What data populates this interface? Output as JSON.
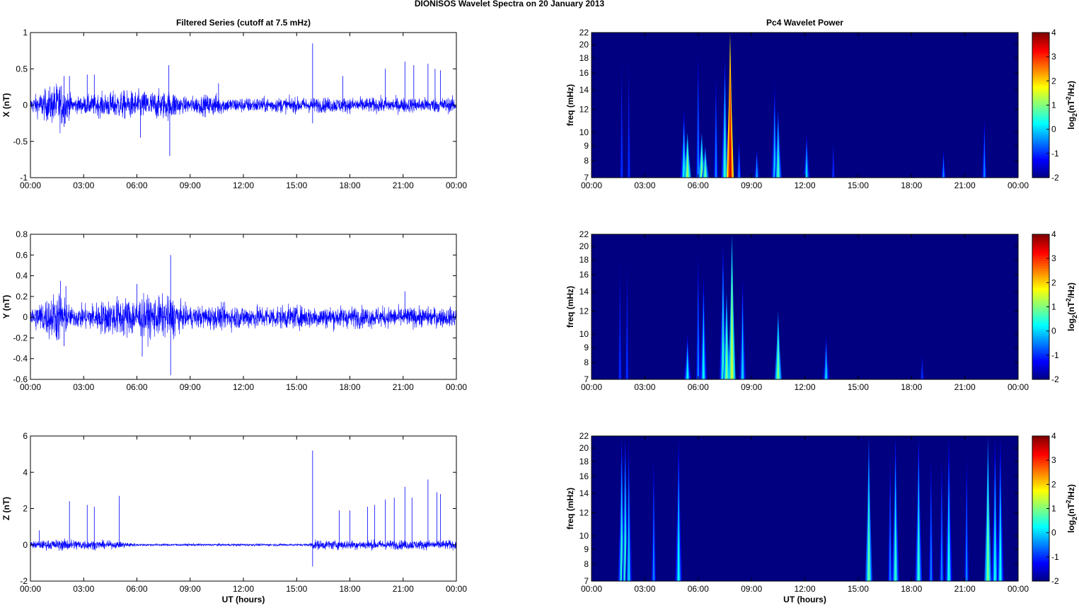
{
  "title": "DIONISOS Wavelet Spectra on 20 January   2013",
  "chart_data": [
    {
      "type": "line",
      "panel": "X",
      "title": "Filtered Series (cutoff at 7.5 mHz)",
      "ylabel": "X (nT)",
      "xlabel": "",
      "ylim": [
        -1,
        1
      ],
      "yticks": [
        "-1",
        "-0.5",
        "0",
        "0.5",
        "1"
      ],
      "ytick_values": [
        -1,
        -0.5,
        0,
        0.5,
        1
      ],
      "xlim": [
        0,
        24
      ],
      "xticks": [
        "00:00",
        "03:00",
        "06:00",
        "09:00",
        "12:00",
        "15:00",
        "18:00",
        "21:00",
        "00:00"
      ],
      "noise_envelope": [
        [
          0,
          0.08
        ],
        [
          1.7,
          0.25
        ],
        [
          2.4,
          0.08
        ],
        [
          5,
          0.15
        ],
        [
          8.2,
          0.15
        ],
        [
          8.5,
          0.08
        ],
        [
          10.5,
          0.12
        ],
        [
          11,
          0.08
        ],
        [
          24,
          0.08
        ]
      ],
      "spikes": [
        [
          1.9,
          0.4
        ],
        [
          2.2,
          0.4
        ],
        [
          1.9,
          -0.3
        ],
        [
          3.2,
          0.42
        ],
        [
          3.6,
          0.42
        ],
        [
          6.2,
          -0.45
        ],
        [
          7.8,
          0.55
        ],
        [
          7.85,
          -0.7
        ],
        [
          10.6,
          0.3
        ],
        [
          15.9,
          0.85
        ],
        [
          15.9,
          -0.25
        ],
        [
          17.6,
          0.4
        ],
        [
          20,
          0.5
        ],
        [
          21.1,
          0.6
        ],
        [
          21.6,
          0.55
        ],
        [
          22.4,
          0.57
        ],
        [
          22.8,
          0.5
        ],
        [
          23.1,
          0.48
        ]
      ]
    },
    {
      "type": "line",
      "panel": "Y",
      "title": "",
      "ylabel": "Y (nT)",
      "xlabel": "",
      "ylim": [
        -0.6,
        0.8
      ],
      "yticks": [
        "-0.6",
        "-0.4",
        "-0.2",
        "0",
        "0.2",
        "0.4",
        "0.6",
        "0.8"
      ],
      "ytick_values": [
        -0.6,
        -0.4,
        -0.2,
        0,
        0.2,
        0.4,
        0.6,
        0.8
      ],
      "xlim": [
        0,
        24
      ],
      "xticks": [
        "00:00",
        "03:00",
        "06:00",
        "09:00",
        "12:00",
        "15:00",
        "18:00",
        "21:00",
        "00:00"
      ],
      "noise_envelope": [
        [
          0,
          0.07
        ],
        [
          1.6,
          0.2
        ],
        [
          2.3,
          0.07
        ],
        [
          5,
          0.15
        ],
        [
          8.2,
          0.15
        ],
        [
          8.6,
          0.08
        ],
        [
          11,
          0.09
        ],
        [
          24,
          0.07
        ]
      ],
      "spikes": [
        [
          1.7,
          0.35
        ],
        [
          2.0,
          0.3
        ],
        [
          1.9,
          -0.28
        ],
        [
          6.0,
          0.32
        ],
        [
          6.3,
          -0.38
        ],
        [
          7.9,
          0.6
        ],
        [
          7.9,
          -0.56
        ],
        [
          21.1,
          0.25
        ]
      ]
    },
    {
      "type": "line",
      "panel": "Z",
      "title": "",
      "ylabel": "Z (nT)",
      "xlabel": "UT (hours)",
      "ylim": [
        -2,
        6
      ],
      "yticks": [
        "-2",
        "0",
        "2",
        "4",
        "6"
      ],
      "ytick_values": [
        -2,
        0,
        2,
        4,
        6
      ],
      "xlim": [
        0,
        24
      ],
      "xticks": [
        "00:00",
        "03:00",
        "06:00",
        "09:00",
        "12:00",
        "15:00",
        "18:00",
        "21:00",
        "00:00"
      ],
      "noise_envelope": [
        [
          0,
          0.15
        ],
        [
          2,
          0.25
        ],
        [
          5.5,
          0.12
        ],
        [
          6,
          0.05
        ],
        [
          15.7,
          0.05
        ],
        [
          15.9,
          0.2
        ],
        [
          24,
          0.2
        ]
      ],
      "spikes": [
        [
          0.5,
          0.8
        ],
        [
          2.2,
          2.4
        ],
        [
          3.2,
          2.2
        ],
        [
          3.6,
          2.1
        ],
        [
          5,
          2.7
        ],
        [
          15.9,
          5.2
        ],
        [
          15.9,
          -1.2
        ],
        [
          17.4,
          1.9
        ],
        [
          18,
          1.9
        ],
        [
          19,
          2.1
        ],
        [
          19.4,
          2.2
        ],
        [
          20,
          2.5
        ],
        [
          20.5,
          2.6
        ],
        [
          21.1,
          3.2
        ],
        [
          21.5,
          2.6
        ],
        [
          22.4,
          3.6
        ],
        [
          22.9,
          2.9
        ],
        [
          23.1,
          2.8
        ]
      ]
    },
    {
      "type": "heatmap",
      "panel": "X",
      "title": "Pc4 Wavelet Power",
      "ylabel": "freq (mHz)",
      "xlabel": "",
      "yscale": "log",
      "ylim": [
        7,
        22
      ],
      "yticks": [
        "7",
        "8",
        "9",
        "10",
        "12",
        "14",
        "16",
        "18",
        "20",
        "22"
      ],
      "ytick_values": [
        7,
        8,
        9,
        10,
        12,
        14,
        16,
        18,
        20,
        22
      ],
      "xlim": [
        0,
        24
      ],
      "xticks": [
        "00:00",
        "03:00",
        "06:00",
        "09:00",
        "12:00",
        "15:00",
        "18:00",
        "21:00",
        "00:00"
      ],
      "colorbar": {
        "label": "log2(nT²/Hz)",
        "range": [
          -2,
          4
        ],
        "ticks": [
          "-2",
          "-1",
          "0",
          "1",
          "2",
          "3",
          "4"
        ]
      },
      "background_level": -2,
      "events": [
        [
          1.7,
          22,
          -1
        ],
        [
          2.1,
          22,
          -1
        ],
        [
          5.2,
          12,
          0.3
        ],
        [
          5.4,
          10,
          1.2
        ],
        [
          6.0,
          22,
          -0.5
        ],
        [
          6.2,
          10,
          1
        ],
        [
          6.4,
          9,
          0.8
        ],
        [
          7.0,
          18,
          -0.5
        ],
        [
          7.5,
          18,
          0.5
        ],
        [
          7.8,
          22,
          3.5
        ],
        [
          8.3,
          10,
          -0.5
        ],
        [
          9.3,
          9,
          -0.3
        ],
        [
          10.3,
          15,
          0
        ],
        [
          10.5,
          12,
          0.6
        ],
        [
          12.1,
          10,
          0
        ],
        [
          13.6,
          10,
          -1
        ],
        [
          19.8,
          9,
          -0.5
        ],
        [
          22.1,
          12,
          -0.5
        ]
      ]
    },
    {
      "type": "heatmap",
      "panel": "Y",
      "title": "",
      "ylabel": "freq (mHz)",
      "xlabel": "",
      "yscale": "log",
      "ylim": [
        7,
        22
      ],
      "yticks": [
        "7",
        "8",
        "9",
        "10",
        "12",
        "14",
        "16",
        "18",
        "20",
        "22"
      ],
      "ytick_values": [
        7,
        8,
        9,
        10,
        12,
        14,
        16,
        18,
        20,
        22
      ],
      "xlim": [
        0,
        24
      ],
      "xticks": [
        "00:00",
        "03:00",
        "06:00",
        "09:00",
        "12:00",
        "15:00",
        "18:00",
        "21:00",
        "00:00"
      ],
      "colorbar": {
        "label": "log2(nT²/Hz)",
        "range": [
          -2,
          4
        ],
        "ticks": [
          "-2",
          "-1",
          "0",
          "1",
          "2",
          "3",
          "4"
        ]
      },
      "background_level": -2,
      "events": [
        [
          1.6,
          22,
          -1
        ],
        [
          2.0,
          22,
          -1
        ],
        [
          5.4,
          10,
          0.2
        ],
        [
          6.0,
          22,
          -0.5
        ],
        [
          6.3,
          16,
          0.2
        ],
        [
          7.4,
          20,
          0.5
        ],
        [
          7.6,
          14,
          1
        ],
        [
          7.9,
          22,
          1.5
        ],
        [
          8.5,
          16,
          0
        ],
        [
          10.5,
          12,
          1
        ],
        [
          13.2,
          10,
          0
        ],
        [
          18.6,
          9,
          -1
        ]
      ]
    },
    {
      "type": "heatmap",
      "panel": "Z",
      "title": "",
      "ylabel": "freq (mHz)",
      "xlabel": "UT (hours)",
      "yscale": "log",
      "ylim": [
        7,
        22
      ],
      "yticks": [
        "7",
        "8",
        "9",
        "10",
        "12",
        "14",
        "16",
        "18",
        "20",
        "22"
      ],
      "ytick_values": [
        7,
        8,
        9,
        10,
        12,
        14,
        16,
        18,
        20,
        22
      ],
      "xlim": [
        0,
        24
      ],
      "xticks": [
        "00:00",
        "03:00",
        "06:00",
        "09:00",
        "12:00",
        "15:00",
        "18:00",
        "21:00",
        "00:00"
      ],
      "colorbar": {
        "label": "log2(nT²/Hz)",
        "range": [
          -2,
          4
        ],
        "ticks": [
          "-2",
          "-1",
          "0",
          "1",
          "2",
          "3",
          "4"
        ]
      },
      "background_level": -2,
      "events": [
        [
          1.7,
          22,
          0.5
        ],
        [
          1.9,
          22,
          0.5
        ],
        [
          2.1,
          22,
          0
        ],
        [
          3.5,
          22,
          -0.5
        ],
        [
          4.9,
          22,
          0.2
        ],
        [
          15.6,
          22,
          0.8
        ],
        [
          16.8,
          22,
          -0.5
        ],
        [
          17.1,
          22,
          0.5
        ],
        [
          18.4,
          22,
          0.5
        ],
        [
          19.1,
          22,
          -0.5
        ],
        [
          19.7,
          22,
          -0.5
        ],
        [
          20.1,
          22,
          0.3
        ],
        [
          21.1,
          22,
          -0.5
        ],
        [
          22.3,
          22,
          1
        ],
        [
          22.7,
          22,
          0.3
        ],
        [
          23.0,
          22,
          0.3
        ]
      ]
    }
  ],
  "colors": {
    "series": "#0000ff",
    "axis": "#000000"
  }
}
